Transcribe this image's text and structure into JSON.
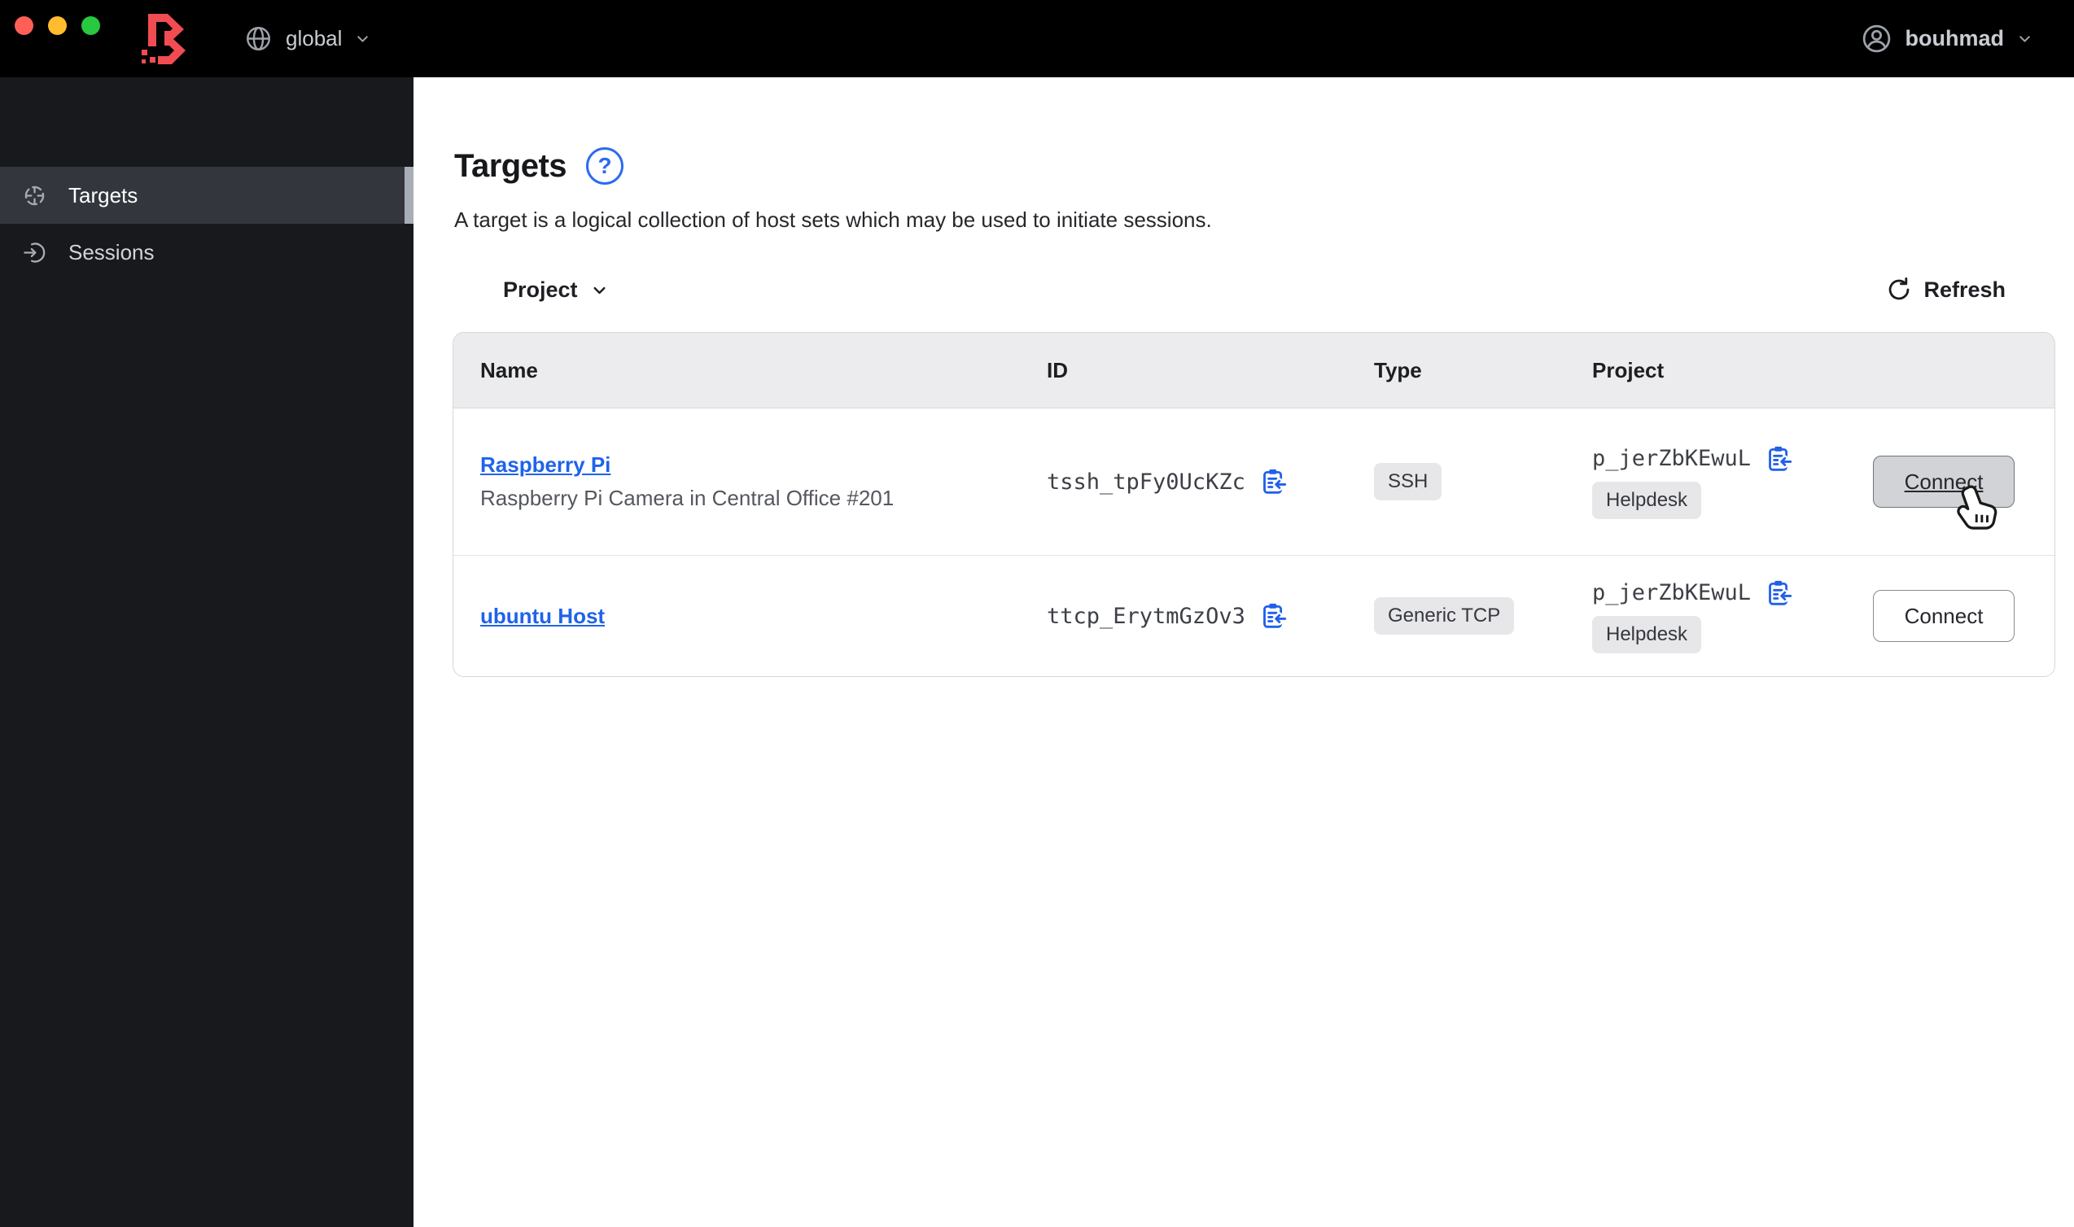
{
  "colors": {
    "brand_red": "#f24c53",
    "accent_blue": "#2160eb",
    "link_blue": "#1f63ea",
    "traffic_red": "#ff5f57",
    "traffic_yellow": "#febc2e",
    "traffic_green": "#28c840"
  },
  "topbar": {
    "logo_icon": "boundary-logo",
    "scope": {
      "icon": "globe-icon",
      "label": "global"
    },
    "user": {
      "icon": "user-circle-icon",
      "label": "bouhmad"
    }
  },
  "sidebar": {
    "items": [
      {
        "icon": "target-icon",
        "label": "Targets",
        "active": true
      },
      {
        "icon": "session-icon",
        "label": "Sessions",
        "active": false
      }
    ]
  },
  "main": {
    "title": "Targets",
    "help_label": "?",
    "description": "A target is a logical collection of host sets which may be used to initiate sessions.",
    "toolbar": {
      "filter_label": "Project",
      "refresh_label": "Refresh"
    },
    "table": {
      "columns": [
        "Name",
        "ID",
        "Type",
        "Project"
      ],
      "rows": [
        {
          "name": "Raspberry Pi",
          "subtitle": "Raspberry Pi Camera in Central Office #201",
          "id": "tssh_tpFy0UcKZc",
          "type": "SSH",
          "project_id": "p_jerZbKEwuL",
          "project_badge": "Helpdesk",
          "action_label": "Connect",
          "action_state": "hovered"
        },
        {
          "name": "ubuntu Host",
          "subtitle": "",
          "id": "ttcp_ErytmGzOv3",
          "type": "Generic TCP",
          "project_id": "p_jerZbKEwuL",
          "project_badge": "Helpdesk",
          "action_label": "Connect",
          "action_state": "default"
        }
      ]
    }
  }
}
